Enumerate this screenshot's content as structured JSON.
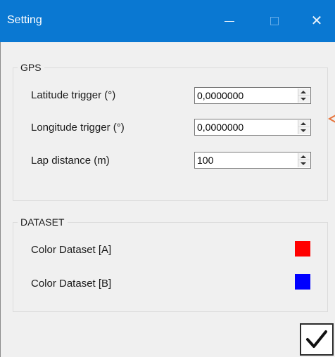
{
  "window": {
    "title": "Setting",
    "minimize_icon": "minimize-icon",
    "maximize_icon": "maximize-icon",
    "close_glyph": "✕"
  },
  "gps": {
    "legend": "GPS",
    "latitude": {
      "label": "Latitude trigger (°)",
      "value": "0,0000000"
    },
    "longitude": {
      "label": "Longitude trigger (°)",
      "value": "0,0000000"
    },
    "lap": {
      "label": "Lap distance (m)",
      "value": "100"
    }
  },
  "dataset": {
    "legend": "DATASET",
    "a": {
      "label": "Color Dataset [A]",
      "color": "#ff0000"
    },
    "b": {
      "label": "Color Dataset [B]",
      "color": "#0000ff"
    }
  },
  "actions": {
    "ok_icon": "checkmark-icon"
  },
  "colors": {
    "titlebar": "#0a78d2",
    "edge_marker": "#e8743b"
  }
}
